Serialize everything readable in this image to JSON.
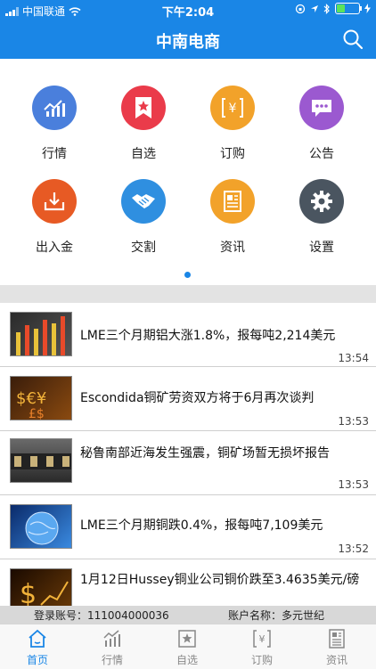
{
  "status_bar": {
    "carrier": "中国联通",
    "time": "下午2:04"
  },
  "header": {
    "title": "中南电商"
  },
  "grid": [
    {
      "label": "行情",
      "icon": "chart-icon",
      "color": "#4a7fdc"
    },
    {
      "label": "自选",
      "icon": "bookmark-star-icon",
      "color": "#ea3b4a"
    },
    {
      "label": "订购",
      "icon": "yen-bracket-icon",
      "color": "#f2a22a"
    },
    {
      "label": "公告",
      "icon": "chat-bubble-icon",
      "color": "#9b59d0"
    },
    {
      "label": "出入金",
      "icon": "download-tray-icon",
      "color": "#e75a24"
    },
    {
      "label": "交割",
      "icon": "handshake-icon",
      "color": "#2f8fe0"
    },
    {
      "label": "资讯",
      "icon": "newspaper-icon",
      "color": "#f2a22a"
    },
    {
      "label": "设置",
      "icon": "gear-icon",
      "color": "#4a5560"
    }
  ],
  "news": [
    {
      "title": "LME三个月期铝大涨1.8%，报每吨2,214美元",
      "time": "13:54"
    },
    {
      "title": "Escondida铜矿劳资双方将于6月再次谈判",
      "time": "13:53"
    },
    {
      "title": "秘鲁南部近海发生强震，铜矿场暂无损坏报告",
      "time": "13:53"
    },
    {
      "title": "LME三个月期铜跌0.4%，报每吨7,109美元",
      "time": "13:52"
    },
    {
      "title": "1月12日Hussey铜业公司铜价跌至3.4635美元/磅",
      "time": ""
    }
  ],
  "account": {
    "account_label": "登录账号：111004000036",
    "name_label": "账户名称：多元世纪"
  },
  "tabs": [
    {
      "label": "首页",
      "icon": "home-icon"
    },
    {
      "label": "行情",
      "icon": "chart-icon"
    },
    {
      "label": "自选",
      "icon": "bookmark-star-icon"
    },
    {
      "label": "订购",
      "icon": "yen-bracket-icon"
    },
    {
      "label": "资讯",
      "icon": "newspaper-icon"
    }
  ],
  "colors": {
    "brand": "#1a86e6"
  }
}
